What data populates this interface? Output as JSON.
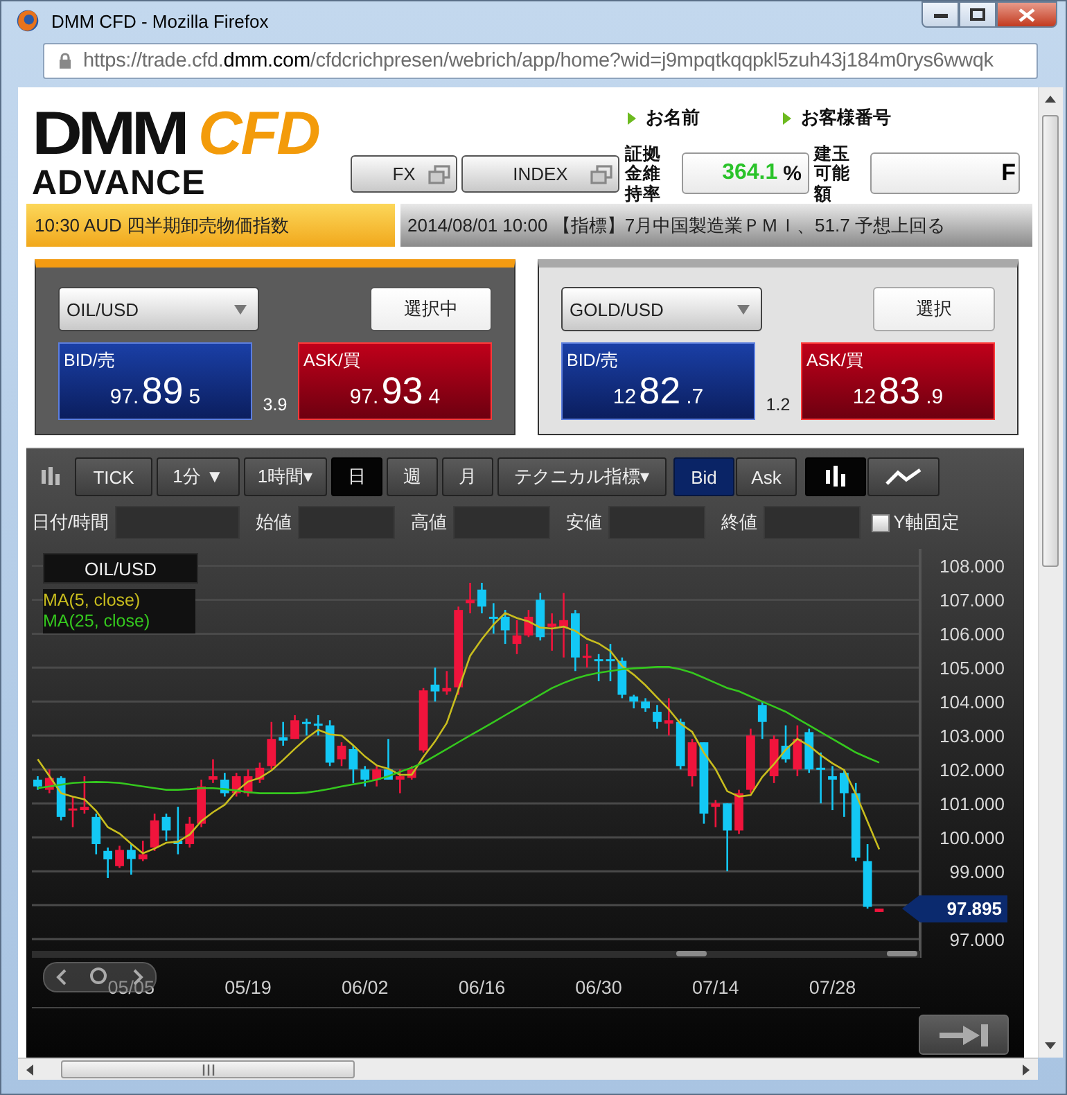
{
  "window": {
    "title": "DMM CFD - Mozilla Firefox"
  },
  "address_bar": {
    "url": "https://trade.cfd.**dmm.com**/cfdcrichpresen/webrich/app/home?wid=j9mpqtkqqpkl5zuh43j184m0rys6wwqk"
  },
  "logo": {
    "brand": "DMM",
    "product": "CFD",
    "edition": "ADVANCE"
  },
  "account": [
    {
      "label": "お名前"
    },
    {
      "label": "お客様番号"
    }
  ],
  "menu_buttons": [
    {
      "label": "FX"
    },
    {
      "label": "INDEX"
    }
  ],
  "margin_rate": {
    "label": "証拠金維持率",
    "value": "364.1",
    "unit": "%"
  },
  "available": {
    "label": "建玉可能額",
    "value": "F"
  },
  "ticker": [
    {
      "kind": "alert",
      "text": "10:30 AUD 四半期卸売物価指数"
    },
    {
      "kind": "news",
      "text": "2014/08/01 10:00 【指標】7月中国製造業ＰＭＩ、51.7 予想上回る"
    }
  ],
  "quote_panels": [
    {
      "symbol": "OIL/USD",
      "button": "選択中",
      "selected": true,
      "bid": {
        "label": "BID/売",
        "head": "97.",
        "big": "89",
        "tail": "5"
      },
      "spread": "3.9",
      "ask": {
        "label": "ASK/買",
        "head": "97.",
        "big": "93",
        "tail": "4"
      }
    },
    {
      "symbol": "GOLD/USD",
      "button": "選択",
      "selected": false,
      "bid": {
        "label": "BID/売",
        "head": "12",
        "big": "82",
        "tail": ".7"
      },
      "spread": "1.2",
      "ask": {
        "label": "ASK/買",
        "head": "12",
        "big": "83",
        "tail": ".9"
      }
    }
  ],
  "chart": {
    "periods": [
      {
        "label": "TICK",
        "selected": false
      },
      {
        "label": "1分 ▼",
        "selected": false
      },
      {
        "label": "1時間▾",
        "selected": false
      },
      {
        "label": "日",
        "selected": true
      },
      {
        "label": "週",
        "selected": false
      },
      {
        "label": "月",
        "selected": false
      }
    ],
    "technical": "テクニカル指標▾",
    "price_sides": [
      {
        "label": "Bid",
        "selected": true
      },
      {
        "label": "Ask",
        "selected": false
      }
    ],
    "chart_types": [
      {
        "kind": "candle",
        "selected": true
      },
      {
        "kind": "line",
        "selected": false
      }
    ],
    "filters": [
      {
        "label": "日付/時間"
      },
      {
        "label": "始値"
      },
      {
        "label": "高値"
      },
      {
        "label": "安値"
      },
      {
        "label": "終値"
      }
    ],
    "y_axis_lock": {
      "label": "Y軸固定",
      "checked": false
    },
    "legend_symbol": "OIL/USD",
    "current_price": "97.895",
    "chart_data": {
      "type": "candlestick",
      "categories": [
        null,
        null,
        null,
        null,
        null,
        null,
        null,
        null,
        "05/05",
        null,
        null,
        null,
        null,
        null,
        null,
        null,
        null,
        null,
        "05/19",
        null,
        null,
        null,
        null,
        null,
        null,
        null,
        null,
        null,
        "06/02",
        null,
        null,
        null,
        null,
        null,
        null,
        null,
        null,
        null,
        "06/16",
        null,
        null,
        null,
        null,
        null,
        null,
        null,
        null,
        null,
        "06/30",
        null,
        null,
        null,
        null,
        null,
        null,
        null,
        null,
        null,
        "07/14",
        null,
        null,
        null,
        null,
        null,
        null,
        null,
        null,
        null,
        "07/28",
        null,
        null,
        null,
        null,
        null,
        null,
        null
      ],
      "ylim": [
        96.45,
        108.5
      ],
      "grid": true,
      "yticks": [
        {
          "value": 97,
          "label": "97.000"
        },
        {
          "value": 99,
          "label": "99.000"
        },
        {
          "value": 100,
          "label": "100.000"
        },
        {
          "value": 101,
          "label": "101.000"
        },
        {
          "value": 102,
          "label": "102.000"
        },
        {
          "value": 103,
          "label": "103.000"
        },
        {
          "value": 104,
          "label": "104.000"
        },
        {
          "value": 105,
          "label": "105.000"
        },
        {
          "value": 106,
          "label": "106.000"
        },
        {
          "value": 107,
          "label": "107.000"
        },
        {
          "value": 108,
          "label": "108.000"
        }
      ],
      "ohlc": [
        [
          101.7,
          101.8,
          101.4,
          101.5
        ],
        [
          101.4,
          102.0,
          101.3,
          101.75
        ],
        [
          101.75,
          101.8,
          100.5,
          100.6
        ],
        [
          100.8,
          101.2,
          100.3,
          100.85
        ],
        [
          100.8,
          101.8,
          100.7,
          100.9
        ],
        [
          100.6,
          100.7,
          99.5,
          99.8
        ],
        [
          99.6,
          99.7,
          98.8,
          99.35
        ],
        [
          99.15,
          99.75,
          99.1,
          99.63
        ],
        [
          99.63,
          99.8,
          98.9,
          99.36
        ],
        [
          99.35,
          99.9,
          99.3,
          99.5
        ],
        [
          99.7,
          100.7,
          99.6,
          100.5
        ],
        [
          100.6,
          100.7,
          99.9,
          100.2
        ],
        [
          99.9,
          100.9,
          99.5,
          99.8
        ],
        [
          99.8,
          100.6,
          99.7,
          100.4
        ],
        [
          100.4,
          101.7,
          100.3,
          101.5
        ],
        [
          101.7,
          102.3,
          101.6,
          101.8
        ],
        [
          101.7,
          101.9,
          101.2,
          101.3
        ],
        [
          101.3,
          101.9,
          101.2,
          101.8
        ],
        [
          101.3,
          102.0,
          101.2,
          101.8
        ],
        [
          101.7,
          102.2,
          101.6,
          102.05
        ],
        [
          102.1,
          103.4,
          102.0,
          102.9
        ],
        [
          102.95,
          103.4,
          102.7,
          102.85
        ],
        [
          102.9,
          103.6,
          102.9,
          103.45
        ],
        [
          103.4,
          103.5,
          103.0,
          103.35
        ],
        [
          103.35,
          103.6,
          103.0,
          103.3
        ],
        [
          103.3,
          103.45,
          102.1,
          102.2
        ],
        [
          102.3,
          102.8,
          102.1,
          102.7
        ],
        [
          102.6,
          102.7,
          101.6,
          102.0
        ],
        [
          102.0,
          102.1,
          101.5,
          101.7
        ],
        [
          101.7,
          102.1,
          101.5,
          102.0
        ],
        [
          102.0,
          102.9,
          101.7,
          101.7
        ],
        [
          101.7,
          102.0,
          101.3,
          101.8
        ],
        [
          101.75,
          102.1,
          101.7,
          102.0
        ],
        [
          102.56,
          104.4,
          102.5,
          104.33
        ],
        [
          104.5,
          105.0,
          104.0,
          104.3
        ],
        [
          104.3,
          104.9,
          104.2,
          104.4
        ],
        [
          104.42,
          106.8,
          104.2,
          106.7
        ],
        [
          106.9,
          107.5,
          106.6,
          107.0
        ],
        [
          107.3,
          107.5,
          106.6,
          106.8
        ],
        [
          106.5,
          106.9,
          106.0,
          106.45
        ],
        [
          106.5,
          106.7,
          105.7,
          106.1
        ],
        [
          105.7,
          106.4,
          105.4,
          105.95
        ],
        [
          105.95,
          106.7,
          105.9,
          106.5
        ],
        [
          107.0,
          107.2,
          105.8,
          105.9
        ],
        [
          106.2,
          106.6,
          105.5,
          106.3
        ],
        [
          106.2,
          107.2,
          105.3,
          106.4
        ],
        [
          106.6,
          106.7,
          104.9,
          105.3
        ],
        [
          105.3,
          105.7,
          105.0,
          105.35
        ],
        [
          105.25,
          105.4,
          104.6,
          105.2
        ],
        [
          105.25,
          105.7,
          104.6,
          105.2
        ],
        [
          105.2,
          105.3,
          104.1,
          104.2
        ],
        [
          104.15,
          104.2,
          103.8,
          104.0
        ],
        [
          104.0,
          104.1,
          103.7,
          103.8
        ],
        [
          103.7,
          103.9,
          103.2,
          103.4
        ],
        [
          103.35,
          104.1,
          103.0,
          103.45
        ],
        [
          103.4,
          103.5,
          102.0,
          102.1
        ],
        [
          101.8,
          102.9,
          101.5,
          102.8
        ],
        [
          102.8,
          102.8,
          100.4,
          100.7
        ],
        [
          100.9,
          101.1,
          100.3,
          101.0
        ],
        [
          101.0,
          101.0,
          99.0,
          100.2
        ],
        [
          100.2,
          101.4,
          100.1,
          101.3
        ],
        [
          101.4,
          103.2,
          101.3,
          103.0
        ],
        [
          103.9,
          104.0,
          102.9,
          103.4
        ],
        [
          101.8,
          103.0,
          101.6,
          102.9
        ],
        [
          102.7,
          103.3,
          102.2,
          102.3
        ],
        [
          102.0,
          103.3,
          101.8,
          102.9
        ],
        [
          103.1,
          103.2,
          101.9,
          102.0
        ],
        [
          102.05,
          102.5,
          101.0,
          102.0
        ],
        [
          101.8,
          102.1,
          100.8,
          101.7
        ],
        [
          101.9,
          102.0,
          100.6,
          101.3
        ],
        [
          101.3,
          101.6,
          99.3,
          99.4
        ],
        [
          99.3,
          99.8,
          97.9,
          97.95
        ],
        [
          97.8,
          97.9,
          97.8,
          97.9
        ],
        null,
        null,
        null
      ],
      "series": [
        {
          "name": "MA(5, close)",
          "type": "line",
          "color": "#c8bd1e",
          "values": [
            102.3,
            101.8,
            101.3,
            101.2,
            101.12,
            100.78,
            100.3,
            100.11,
            99.81,
            99.53,
            99.67,
            99.84,
            99.87,
            100.08,
            100.48,
            100.74,
            100.96,
            101.36,
            101.64,
            101.75,
            101.97,
            102.28,
            102.61,
            102.92,
            103.17,
            103.03,
            103.0,
            102.71,
            102.38,
            102.12,
            102.02,
            101.84,
            101.84,
            102.37,
            102.83,
            103.37,
            104.35,
            105.35,
            105.84,
            106.27,
            106.61,
            106.46,
            106.36,
            106.18,
            106.15,
            106.21,
            106.08,
            105.85,
            105.71,
            105.49,
            105.05,
            104.79,
            104.48,
            104.12,
            103.77,
            103.35,
            103.11,
            102.49,
            102.01,
            101.36,
            101.2,
            101.24,
            101.78,
            102.16,
            102.58,
            102.9,
            102.7,
            102.42,
            102.18,
            101.98,
            101.28,
            100.47,
            99.65,
            null,
            null,
            null
          ]
        },
        {
          "name": "MA(25, close)",
          "type": "line",
          "color": "#35c81e",
          "values": [
            101.45,
            101.5,
            101.55,
            101.6,
            101.62,
            101.63,
            101.62,
            101.6,
            101.55,
            101.5,
            101.45,
            101.4,
            101.4,
            101.42,
            101.45,
            101.45,
            101.42,
            101.38,
            101.33,
            101.3,
            101.3,
            101.3,
            101.3,
            101.32,
            101.37,
            101.43,
            101.5,
            101.56,
            101.62,
            101.7,
            101.8,
            101.93,
            102.05,
            102.2,
            102.4,
            102.6,
            102.8,
            103.0,
            103.2,
            103.4,
            103.6,
            103.8,
            104.0,
            104.2,
            104.4,
            104.55,
            104.68,
            104.78,
            104.85,
            104.9,
            104.95,
            104.98,
            105.0,
            105.02,
            105.02,
            104.95,
            104.85,
            104.7,
            104.55,
            104.4,
            104.3,
            104.15,
            104.0,
            103.85,
            103.7,
            103.5,
            103.3,
            103.1,
            102.9,
            102.7,
            102.5,
            102.35,
            102.2,
            null,
            null,
            null
          ]
        }
      ]
    }
  }
}
